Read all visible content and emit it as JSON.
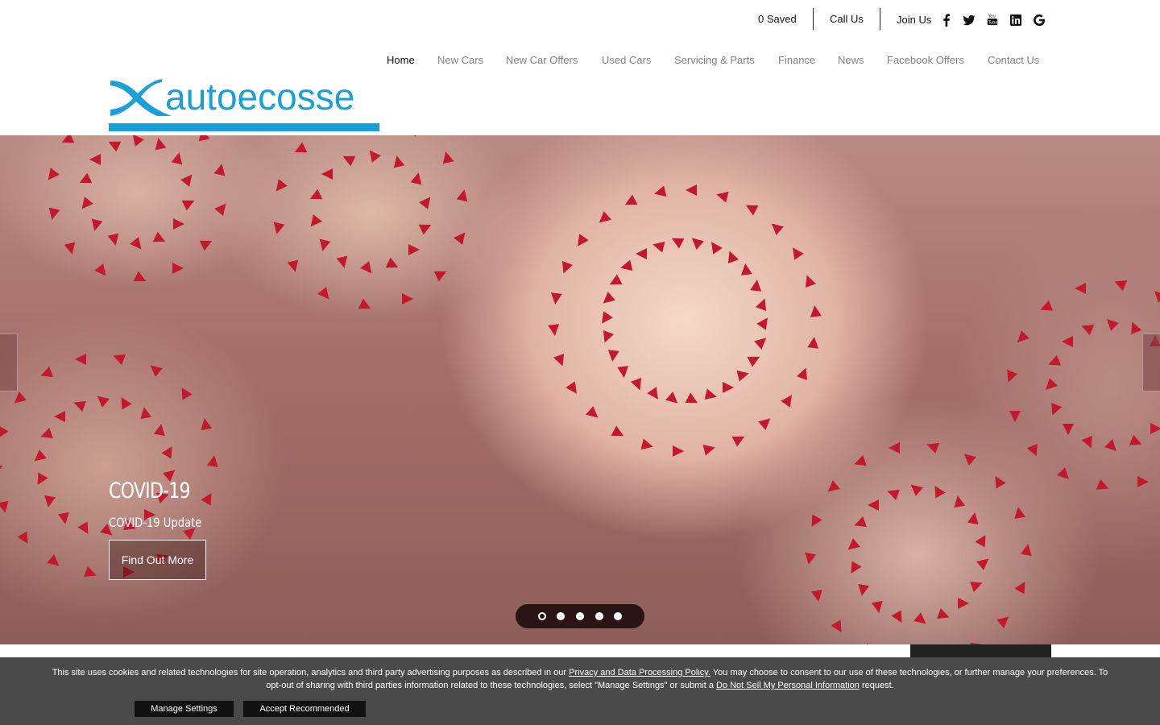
{
  "utility": {
    "saved_label": "0 Saved",
    "call_label": "Call Us",
    "join_label": "Join Us",
    "social_icons": [
      "facebook-icon",
      "twitter-icon",
      "youtube-icon",
      "linkedin-icon",
      "google-icon"
    ]
  },
  "nav": {
    "items": [
      {
        "label": "Home",
        "active": true
      },
      {
        "label": "New Cars"
      },
      {
        "label": "New Car Offers"
      },
      {
        "label": "Used Cars"
      },
      {
        "label": "Servicing & Parts"
      },
      {
        "label": "Finance"
      },
      {
        "label": "News"
      },
      {
        "label": "Facebook Offers"
      },
      {
        "label": "Contact Us"
      }
    ]
  },
  "logo": {
    "text": "autoecosse",
    "color": "#1aa0d8"
  },
  "hero": {
    "title": "COVID-19",
    "subtitle": "COVID-19 Update",
    "button_label": "Find Out More",
    "slide_count": 5,
    "active_slide": 1
  },
  "cookie_banner": {
    "text_part1": "This site uses cookies and related technologies for site operation, analytics and third party advertising purposes as described in our ",
    "privacy_link": "Privacy and Data Processing Policy.",
    "text_part2": " You may choose to consent to our use of these technologies, or further manage your preferences. To opt-out of sharing with third parties information related to these technologies, select \"Manage Settings\" or submit a ",
    "donotsell_link": "Do Not Sell My Personal Information",
    "text_part3": " request.",
    "manage_label": "Manage Settings",
    "accept_label": "Accept Recommended"
  }
}
